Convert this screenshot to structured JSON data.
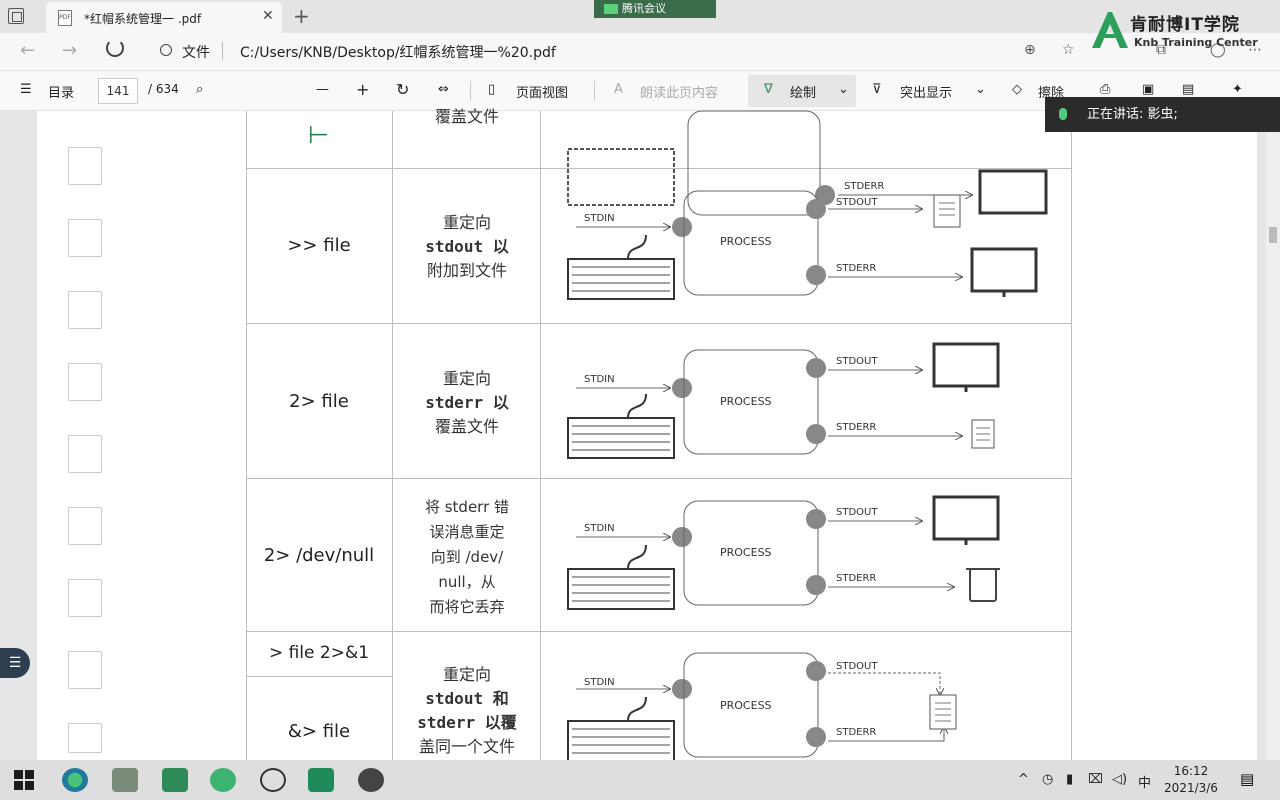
{
  "window": {
    "tab_title": "*红帽系统管理一 .pdf",
    "tab_close": "✕",
    "new_tab": "+"
  },
  "meeting": {
    "label": "腾讯会议"
  },
  "brand": {
    "name_cn": "肯耐博IT学院",
    "name_en": "Knb Training Center"
  },
  "address": {
    "file_label": "文件",
    "url": "C:/Users/KNB/Desktop/红帽系统管理一%20.pdf"
  },
  "toolbar": {
    "toc": "目录",
    "page": "141",
    "total": "/ 634",
    "page_view": "页面视图",
    "read_aloud": "朗读此页内容",
    "draw": "绘制",
    "highlight": "突出显示",
    "erase": "擦除"
  },
  "speaking": {
    "text": "正在讲话: 影虫;"
  },
  "table": {
    "rows": [
      {
        "cmd": "",
        "desc": "覆盖文件",
        "out_label": "",
        "err_label": "STDERR"
      },
      {
        "cmd": ">> file",
        "desc_lines": [
          "重定向",
          "stdout 以",
          "附加到文件"
        ],
        "in_label": "STDIN",
        "proc": "PROCESS",
        "out_label": "STDOUT",
        "err_label": "STDERR"
      },
      {
        "cmd": "2> file",
        "desc_lines": [
          "重定向",
          "stderr 以",
          "覆盖文件"
        ],
        "in_label": "STDIN",
        "proc": "PROCESS",
        "out_label": "STDOUT",
        "err_label": "STDERR"
      },
      {
        "cmd": "2> /dev/null",
        "desc_lines": [
          "将 stderr 错",
          "误消息重定",
          "向到 /dev/",
          "null，从",
          "而将它丢弃"
        ],
        "in_label": "STDIN",
        "proc": "PROCESS",
        "out_label": "STDOUT",
        "err_label": "STDERR"
      },
      {
        "cmd": "> file  2>&1",
        "cmd2": "&> file",
        "desc_lines": [
          "重定向",
          "stdout 和",
          "stderr 以覆",
          "盖同一个文件"
        ],
        "in_label": "STDIN",
        "proc": "PROCESS",
        "out_label": "STDOUT",
        "err_label": "STDERR"
      }
    ]
  },
  "taskbar": {
    "ime": "中",
    "time": "16:12",
    "date": "2021/3/6"
  },
  "colors": {
    "green": "#28b463",
    "overlay": "#2b2b2b"
  }
}
